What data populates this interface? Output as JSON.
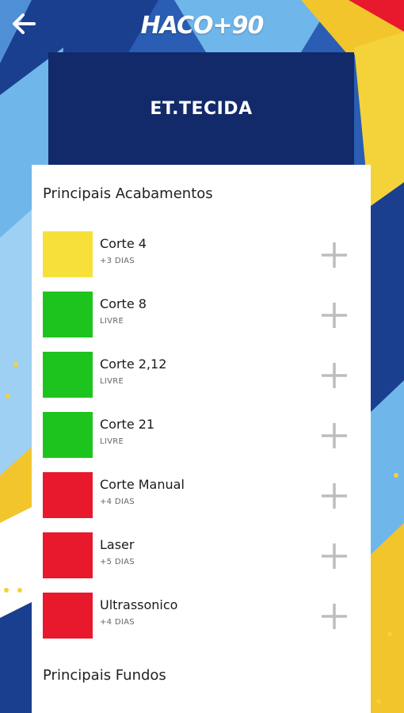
{
  "app": {
    "logo_text": "HACO+90"
  },
  "header": {
    "title": "ET.TECIDA"
  },
  "sections": {
    "acabamentos_title": "Principais Acabamentos",
    "fundos_title": "Principais Fundos"
  },
  "status_colors": {
    "yellow": "#f7e03a",
    "green": "#1ec41e",
    "red": "#e8192c"
  },
  "items": [
    {
      "name": "Corte 4",
      "status": "+3 DIAS",
      "color": "#f7e03a"
    },
    {
      "name": "Corte 8",
      "status": "LIVRE",
      "color": "#1ec41e"
    },
    {
      "name": "Corte 2,12",
      "status": "LIVRE",
      "color": "#1ec41e"
    },
    {
      "name": "Corte 21",
      "status": "LIVRE",
      "color": "#1ec41e"
    },
    {
      "name": "Corte Manual",
      "status": "+4 DIAS",
      "color": "#e8192c"
    },
    {
      "name": "Laser",
      "status": "+5 DIAS",
      "color": "#e8192c"
    },
    {
      "name": "Ultrassonico",
      "status": "+4 DIAS",
      "color": "#e8192c"
    }
  ],
  "icons": {
    "back": "arrow-left-icon",
    "add": "plus-icon"
  }
}
